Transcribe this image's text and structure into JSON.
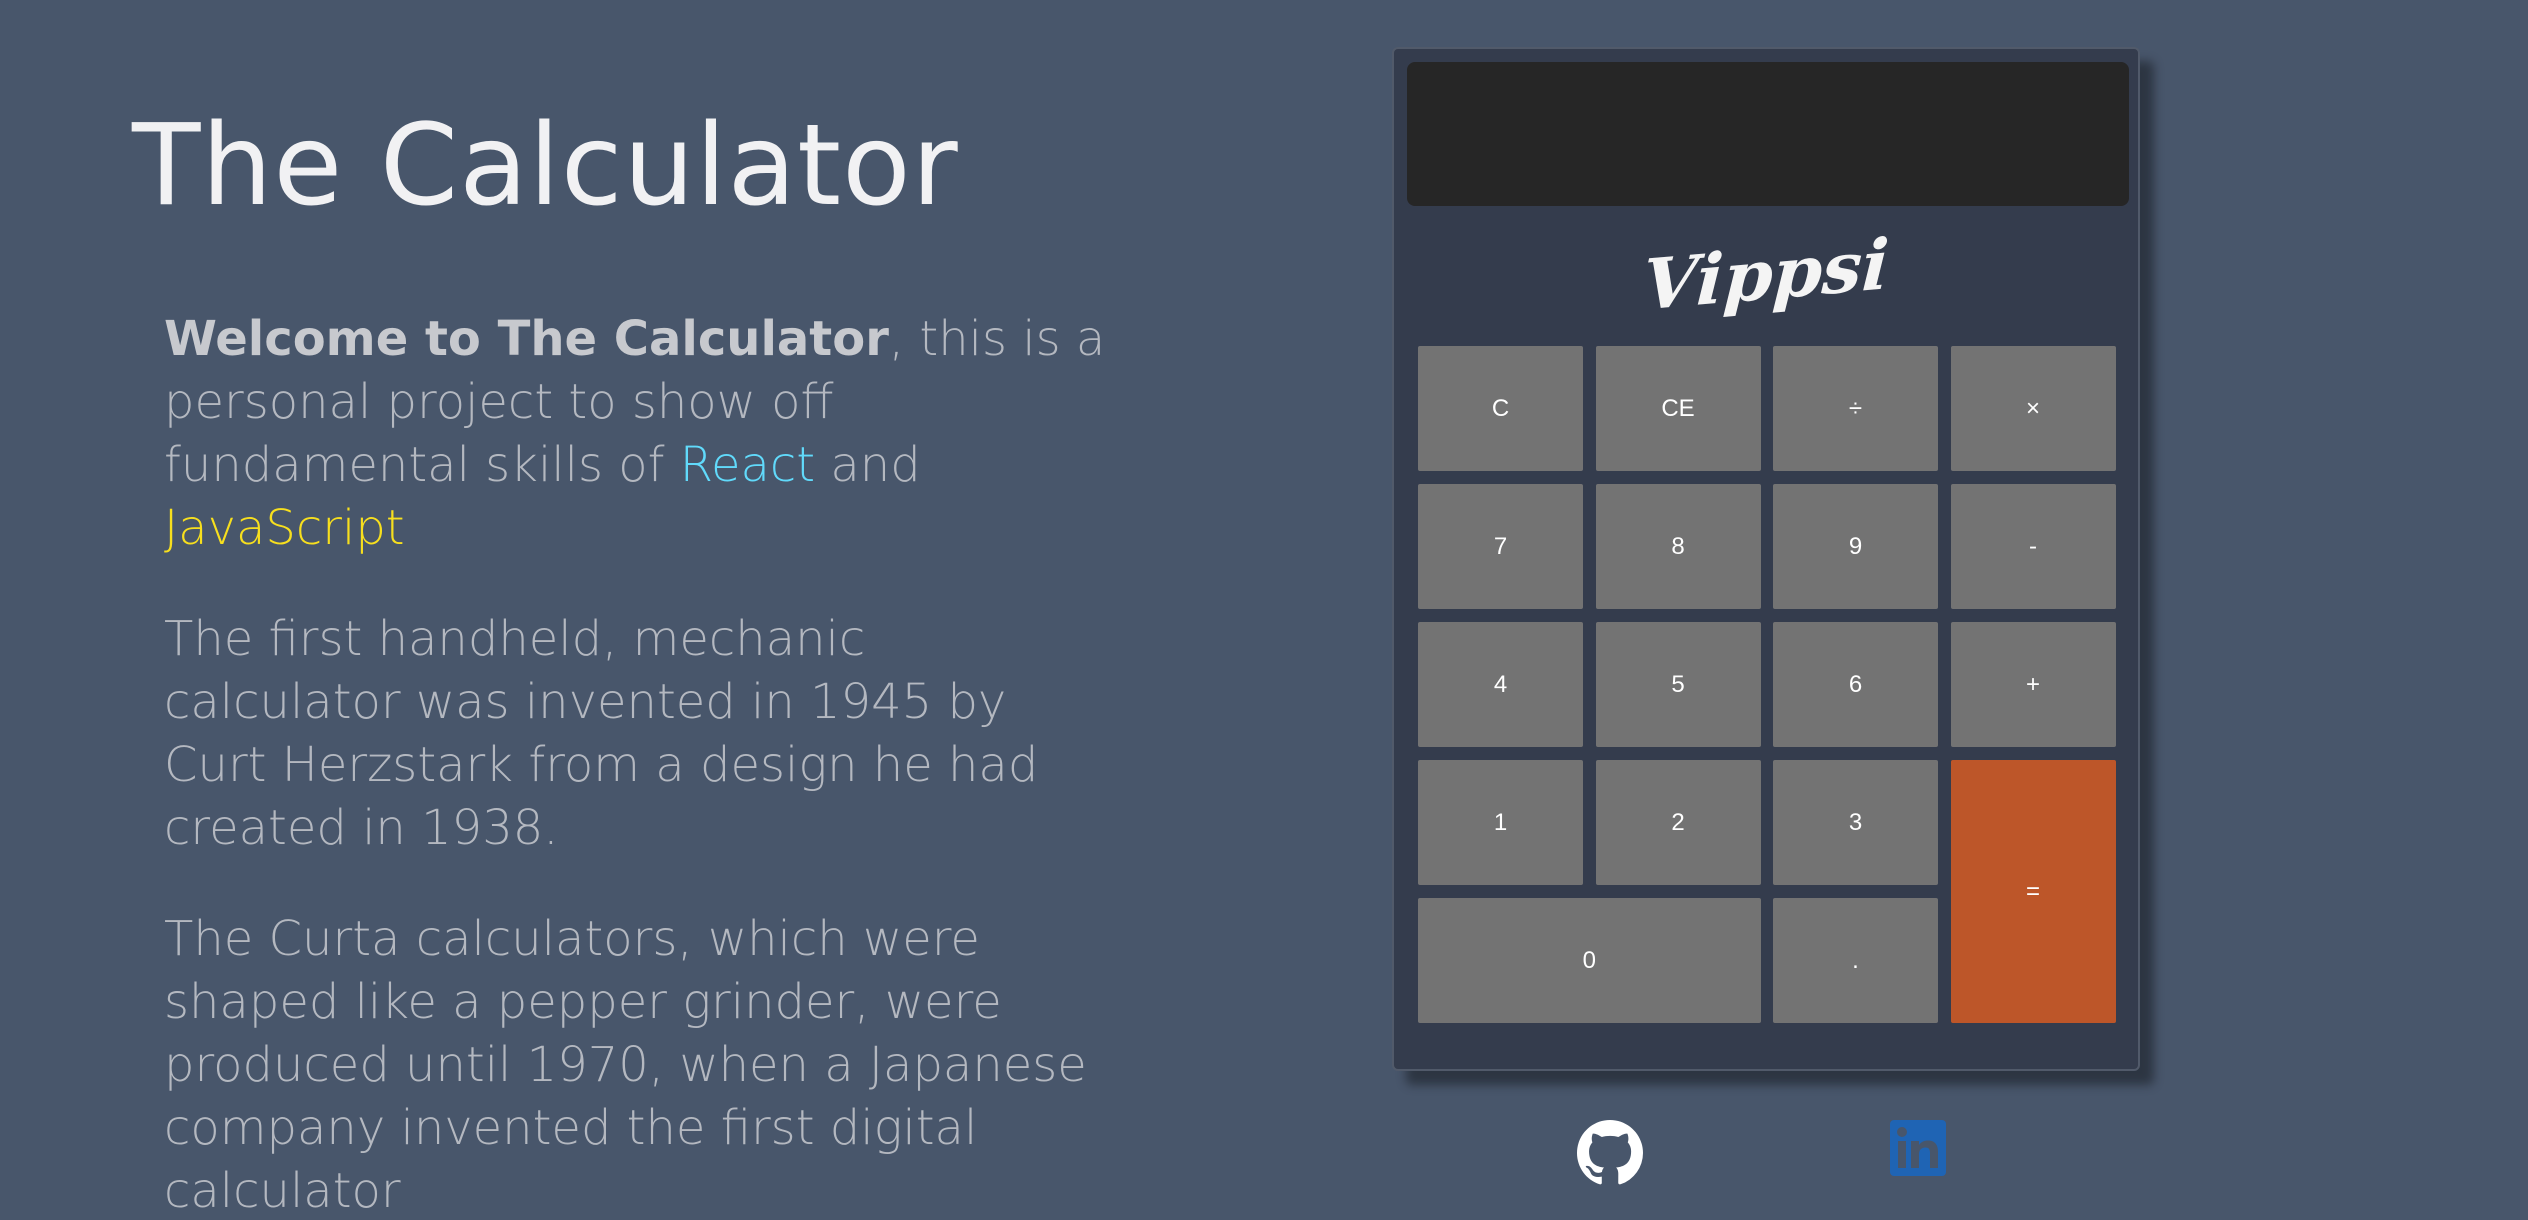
{
  "page": {
    "title": "The Calculator"
  },
  "intro": {
    "welcome_bold": "Welcome to The Calculator",
    "welcome_rest": ", this is a personal project to show off fundamental skills of ",
    "react": "React",
    "and": " and ",
    "javascript": "JavaScript",
    "paragraph2": "The first handheld, mechanic calculator was invented in 1945 by Curt Herzstark from a design he had created in 1938.",
    "paragraph3": "The Curta calculators, which were shaped like a pepper grinder, were produced until 1970, when a Japanese company invented the first digital calculator"
  },
  "calculator": {
    "display_value": "",
    "brand": "Vippsi",
    "keys": {
      "clear": "C",
      "clear_entry": "CE",
      "divide": "÷",
      "multiply": "×",
      "seven": "7",
      "eight": "8",
      "nine": "9",
      "minus": "-",
      "four": "4",
      "five": "5",
      "six": "6",
      "plus": "+",
      "one": "1",
      "two": "2",
      "three": "3",
      "equals": "=",
      "zero": "0",
      "dot": "."
    }
  },
  "social": {
    "github_icon": "github-icon",
    "linkedin_icon": "linkedin-icon"
  },
  "colors": {
    "background": "#48566b",
    "calculator_body": "#343c4d",
    "display": "#262626",
    "key": "#737373",
    "equals_key": "#bd5629",
    "react": "#61dafb",
    "javascript": "#f7df1e",
    "linkedin": "#1f64b4"
  }
}
